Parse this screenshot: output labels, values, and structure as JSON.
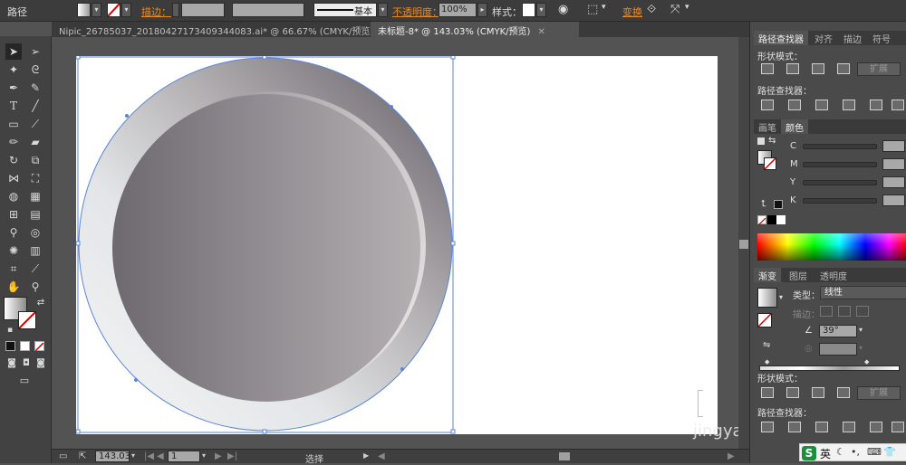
{
  "control_bar": {
    "selection_type": "路径",
    "stroke_label": "描边：",
    "stroke_profile": "基本",
    "opacity_label": "不透明度：",
    "opacity_value": "100%",
    "style_label": "样式：",
    "transform_label": "变换"
  },
  "tabs": [
    {
      "label": "Nipic_26785037_20180427173409344083.ai* @ 66.67% (CMYK/预览)",
      "active": false
    },
    {
      "label": "未标题-8* @ 143.03% (CMYK/预览)",
      "active": true
    }
  ],
  "status": {
    "zoom": "143.03",
    "artboard": "1",
    "tool_state": "选择"
  },
  "pathfinder_panel": {
    "tabs": [
      "路径查找器",
      "对齐",
      "描边",
      "符号"
    ],
    "shape_modes_label": "形状模式：",
    "expand_label": "扩展",
    "pathfinders_label": "路径查找器："
  },
  "color_panel": {
    "tabs": [
      "画笔",
      "颜色"
    ],
    "channels": [
      "C",
      "M",
      "Y",
      "K"
    ]
  },
  "gradient_panel": {
    "tabs": [
      "渐变",
      "图层",
      "透明度"
    ],
    "type_label": "类型：",
    "type_value": "线性",
    "stroke_label": "描边：",
    "angle_value": "39°",
    "shape_modes_label": "形状模式：",
    "expand_label": "扩展",
    "pathfinders_label": "路径查找器："
  },
  "watermark": "jingyan",
  "ime": {
    "badge": "S",
    "mode": "英"
  }
}
